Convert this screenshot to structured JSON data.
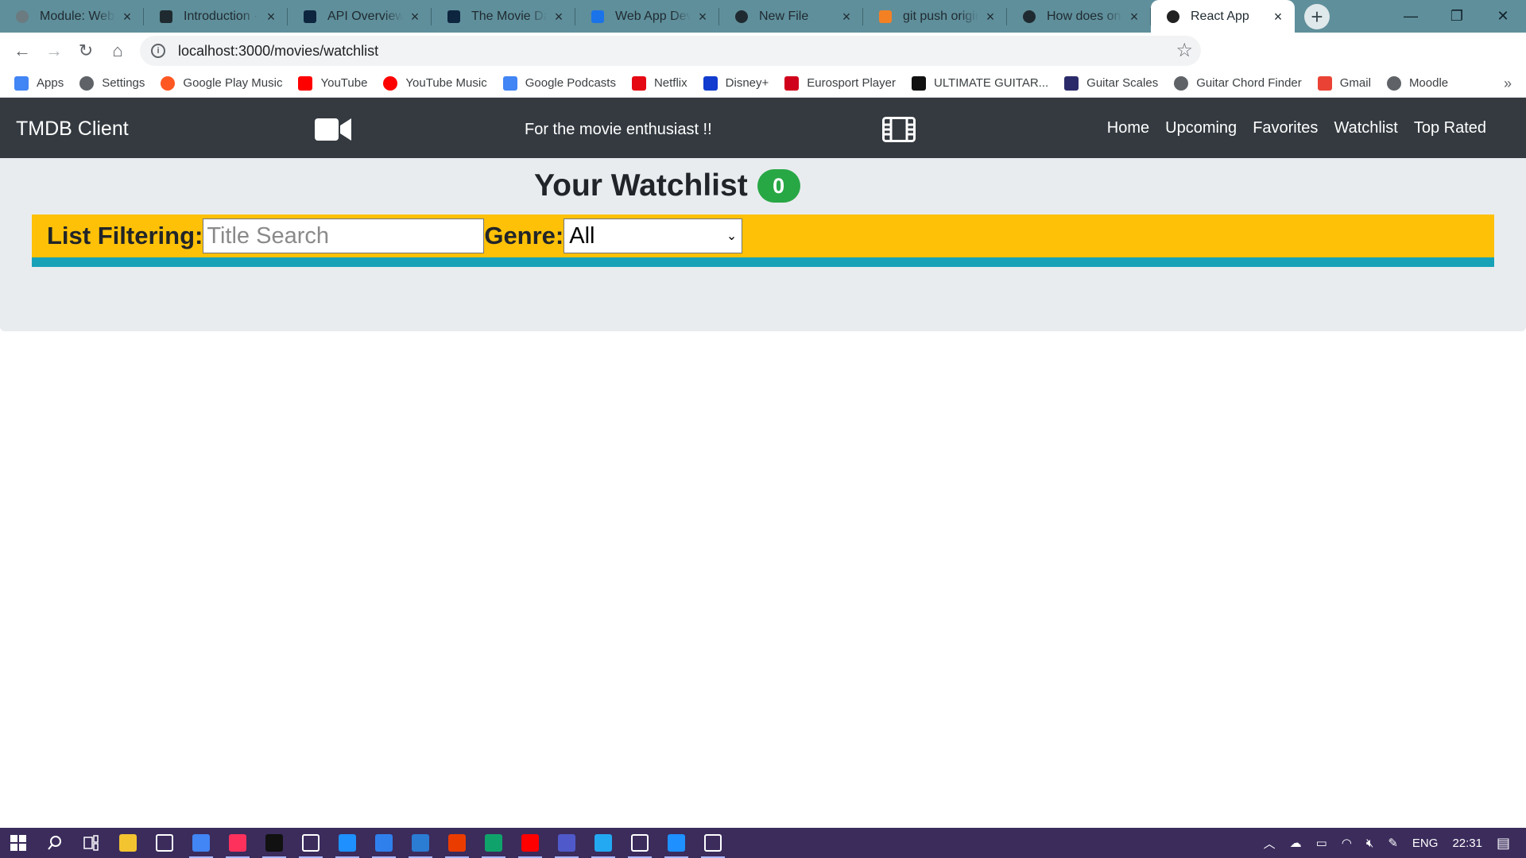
{
  "browser": {
    "tabs": [
      {
        "title": "Module: Web A",
        "icon": "globe-icon",
        "color": "#6b7b80",
        "active": false
      },
      {
        "title": "Introduction · C",
        "icon": "book-icon",
        "color": "#1f2a30",
        "active": false
      },
      {
        "title": "API Overview —",
        "icon": "tmdb-icon",
        "color": "#0d253f",
        "active": false
      },
      {
        "title": "The Movie Dat",
        "icon": "tmdb-icon",
        "color": "#0d253f",
        "active": false
      },
      {
        "title": "Web App Deve",
        "icon": "devices-icon",
        "color": "#1a73e8",
        "active": false
      },
      {
        "title": "New File",
        "icon": "github-icon",
        "color": "#1f2a30",
        "active": false
      },
      {
        "title": "git push origin",
        "icon": "stackoverflow-icon",
        "color": "#f48024",
        "active": false
      },
      {
        "title": "How does one",
        "icon": "github-icon",
        "color": "#1f2a30",
        "active": false
      },
      {
        "title": "React App",
        "icon": "react-icon",
        "color": "#222222",
        "active": true
      }
    ],
    "new_tab_label": "+",
    "window_controls": {
      "minimize": "—",
      "maximize": "❐",
      "close": "✕"
    },
    "url": "localhost:3000/movies/watchlist",
    "nav": {
      "back": "←",
      "forward": "→",
      "reload": "↻",
      "home": "⌂"
    },
    "extensions": [
      "extension-1",
      "chrome-icon",
      "fonts",
      "extension-2",
      "extension-3",
      "extension-4",
      "puzzle-icon",
      "profile-avatar"
    ]
  },
  "bookmarks": [
    {
      "label": "Apps",
      "icon": "apps-grid-icon",
      "color": "#4285f4"
    },
    {
      "label": "Settings",
      "icon": "gear-icon",
      "color": "#5f6368"
    },
    {
      "label": "Google Play Music",
      "icon": "play-music-icon",
      "color": "#ff5722"
    },
    {
      "label": "YouTube",
      "icon": "youtube-icon",
      "color": "#ff0000"
    },
    {
      "label": "YouTube Music",
      "icon": "youtube-music-icon",
      "color": "#ff0000"
    },
    {
      "label": "Google Podcasts",
      "icon": "podcasts-icon",
      "color": "#4285f4"
    },
    {
      "label": "Netflix",
      "icon": "netflix-icon",
      "color": "#e50914"
    },
    {
      "label": "Disney+",
      "icon": "disney-icon",
      "color": "#113ccf"
    },
    {
      "label": "Eurosport Player",
      "icon": "eurosport-icon",
      "color": "#d0021b"
    },
    {
      "label": "ULTIMATE GUITAR...",
      "icon": "ultimate-guitar-icon",
      "color": "#111111"
    },
    {
      "label": "Guitar Scales",
      "icon": "guitar-scales-icon",
      "color": "#2a2a6a"
    },
    {
      "label": "Guitar Chord Finder",
      "icon": "globe-icon",
      "color": "#5f6368"
    },
    {
      "label": "Gmail",
      "icon": "gmail-icon",
      "color": "#ea4335"
    },
    {
      "label": "Moodle",
      "icon": "globe-icon",
      "color": "#5f6368"
    }
  ],
  "bookmarks_more": "»",
  "app": {
    "brand": "TMDB Client",
    "tagline": "For the movie enthusiast !!",
    "nav_links": [
      "Home",
      "Upcoming",
      "Favorites",
      "Watchlist",
      "Top Rated"
    ],
    "heading": "Your Watchlist",
    "count": "0",
    "filter": {
      "label": "List Filtering:",
      "search_placeholder": "Title Search",
      "search_value": "",
      "genre_label": "Genre:",
      "genre_selected": "All"
    },
    "colors": {
      "navbar": "#343a40",
      "badge": "#28a745",
      "filter_bar": "#ffc107",
      "accent_bar": "#17a2b8",
      "jumbotron": "#e9ecef"
    }
  },
  "taskbar": {
    "apps": [
      {
        "name": "start-icon",
        "color": "#ffffff"
      },
      {
        "name": "search-icon",
        "color": "#ffffff"
      },
      {
        "name": "task-view-icon",
        "color": "#ffffff"
      },
      {
        "name": "file-explorer-icon",
        "color": "#f4c430"
      },
      {
        "name": "settings-icon",
        "color": "#ffffff"
      },
      {
        "name": "chrome-icon",
        "color": "#4285f4"
      },
      {
        "name": "intellij-icon",
        "color": "#fe315d"
      },
      {
        "name": "zoom-icon",
        "color": "#111111"
      },
      {
        "name": "app-icon-1",
        "color": "#ffffff"
      },
      {
        "name": "photos-icon",
        "color": "#1e90ff"
      },
      {
        "name": "todo-icon",
        "color": "#2f80ed"
      },
      {
        "name": "word-icon",
        "color": "#2b7cd3"
      },
      {
        "name": "office-icon",
        "color": "#eb3c00"
      },
      {
        "name": "edge-icon",
        "color": "#0fa36b"
      },
      {
        "name": "youtube-music-icon",
        "color": "#ff0000"
      },
      {
        "name": "teams-icon",
        "color": "#5059c9"
      },
      {
        "name": "vscode-icon",
        "color": "#23a9f2"
      },
      {
        "name": "slack-icon",
        "color": "#ffffff"
      },
      {
        "name": "app-icon-2",
        "color": "#1e90ff"
      },
      {
        "name": "app-icon-3",
        "color": "#ffffff"
      }
    ],
    "tray": {
      "language": "ENG",
      "time": "22:31"
    }
  }
}
